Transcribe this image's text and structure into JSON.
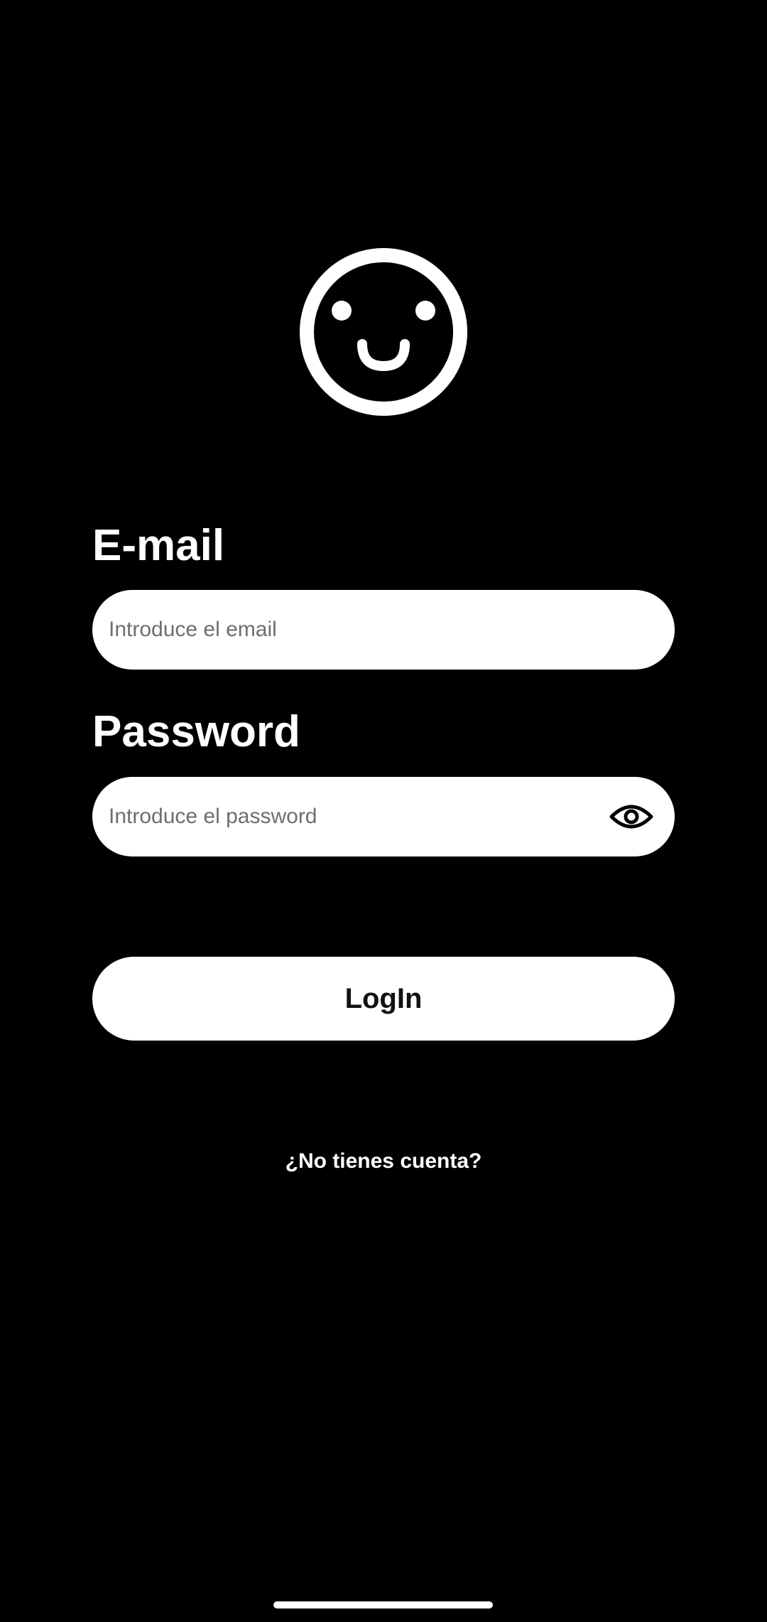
{
  "logo": {
    "icon": "smiley-face-icon"
  },
  "email": {
    "label": "E-mail",
    "placeholder": "Introduce el email",
    "value": ""
  },
  "password": {
    "label": "Password",
    "placeholder": "Introduce el password",
    "value": "",
    "toggle_icon": "eye-icon"
  },
  "login": {
    "label": "LogIn"
  },
  "signup": {
    "label": "¿No tienes cuenta?"
  },
  "colors": {
    "background": "#000000",
    "foreground": "#ffffff",
    "placeholder": "#6e6e6e"
  }
}
